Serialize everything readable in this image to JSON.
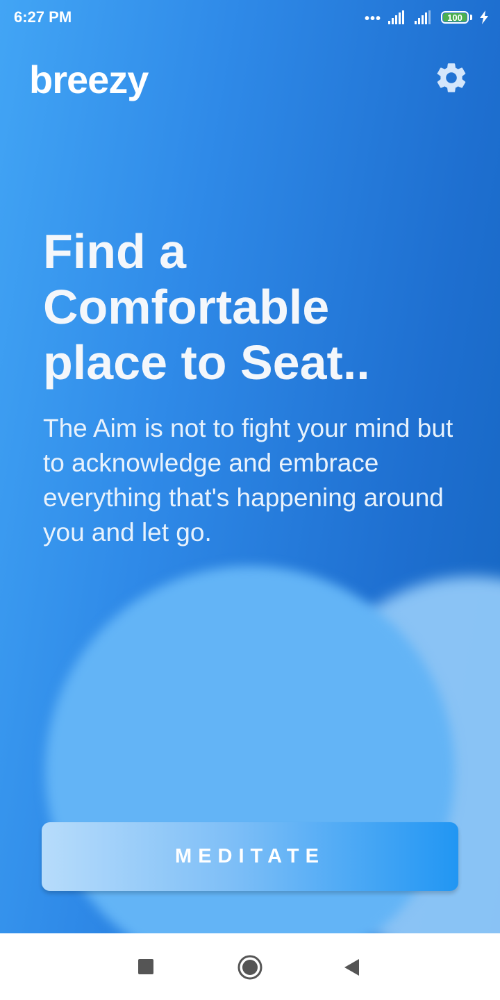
{
  "status_bar": {
    "time": "6:27 PM",
    "signal_dots": "•••",
    "battery_level": "100",
    "icons": [
      "signal-icon",
      "signal-icon",
      "battery-icon",
      "charging-bolt-icon"
    ]
  },
  "header": {
    "logo": "breezy",
    "settings_icon": "gear-icon"
  },
  "main": {
    "headline": "Find a Comfortable place to Seat..",
    "description": "The Aim is not to fight your mind but to acknowledge and embrace everything that's happening around you and let go.",
    "button_label": "MEDITATE"
  },
  "nav_bar": {
    "icons": [
      "square-recents-icon",
      "circle-home-icon",
      "triangle-back-icon"
    ]
  },
  "colors": {
    "background_start": "#42a5f5",
    "background_end": "#1565c0",
    "button_end": "#2196f3",
    "battery": "#4caf50"
  }
}
